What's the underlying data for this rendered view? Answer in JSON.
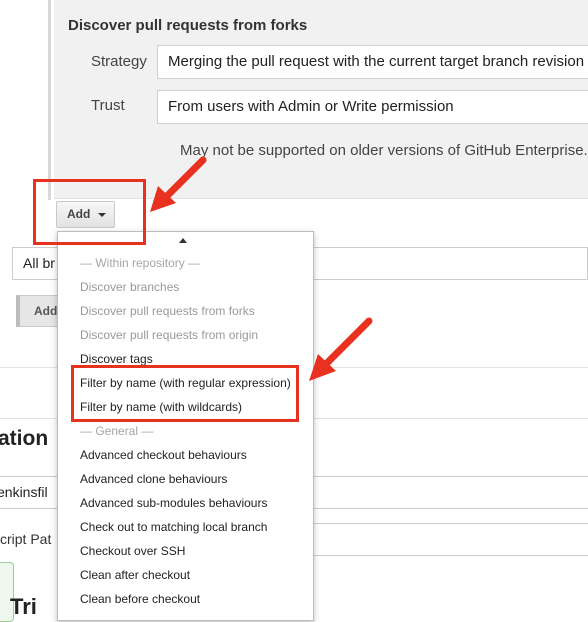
{
  "section": {
    "title": "Discover pull requests from forks",
    "strategy_label": "Strategy",
    "strategy_value": "Merging the pull request with the current target branch revision",
    "trust_label": "Trust",
    "trust_value": "From users with Admin or Write permission",
    "note": "May not be supported on older versions of GitHub Enterprise."
  },
  "add_button": {
    "label": "Add"
  },
  "background": {
    "select_value": "All br",
    "add_button_label": "Add",
    "heading_fragment": "ation",
    "script_field_value": "enkinsfil",
    "script_label_fragment": "cript Pat",
    "bottom_heading_fragment": "Tri"
  },
  "menu": {
    "items": [
      {
        "label": "— Within repository —",
        "state": "header"
      },
      {
        "label": "Discover branches",
        "state": "disabled"
      },
      {
        "label": "Discover pull requests from forks",
        "state": "disabled"
      },
      {
        "label": "Discover pull requests from origin",
        "state": "disabled"
      },
      {
        "label": "Discover tags",
        "state": "enabled"
      },
      {
        "label": "Filter by name (with regular expression)",
        "state": "enabled"
      },
      {
        "label": "Filter by name (with wildcards)",
        "state": "enabled"
      },
      {
        "label": "— General —",
        "state": "header"
      },
      {
        "label": "Advanced checkout behaviours",
        "state": "enabled"
      },
      {
        "label": "Advanced clone behaviours",
        "state": "enabled"
      },
      {
        "label": "Advanced sub-modules behaviours",
        "state": "enabled"
      },
      {
        "label": "Check out to matching local branch",
        "state": "enabled"
      },
      {
        "label": "Checkout over SSH",
        "state": "enabled"
      },
      {
        "label": "Clean after checkout",
        "state": "enabled"
      },
      {
        "label": "Clean before checkout",
        "state": "enabled"
      }
    ]
  },
  "annotations": {
    "highlight_color": "#e8321f"
  }
}
